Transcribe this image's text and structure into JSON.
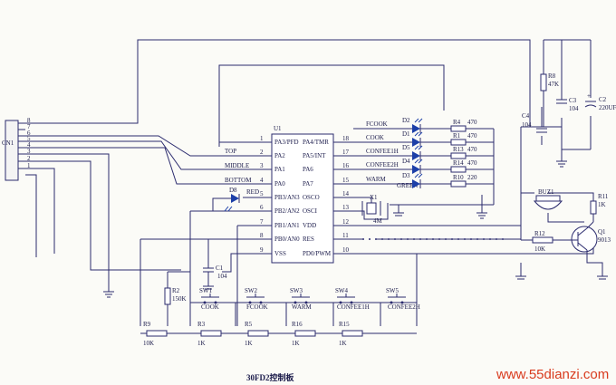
{
  "connector": {
    "ref": "CN1",
    "pins": [
      "8",
      "7",
      "6",
      "5",
      "4",
      "3",
      "2",
      "1"
    ]
  },
  "ic": {
    "ref": "U1",
    "left_pins": [
      {
        "num": "1",
        "name": "PA3/PFD"
      },
      {
        "num": "2",
        "name": "PA2"
      },
      {
        "num": "3",
        "name": "PA1"
      },
      {
        "num": "4",
        "name": "PA0"
      },
      {
        "num": "5",
        "name": "PB3/AN3"
      },
      {
        "num": "6",
        "name": "PB2/AN2"
      },
      {
        "num": "7",
        "name": "PB1/AN1"
      },
      {
        "num": "8",
        "name": "PB0/AN0"
      },
      {
        "num": "9",
        "name": "VSS"
      }
    ],
    "right_pins": [
      {
        "num": "18",
        "name": "PA4/TMR"
      },
      {
        "num": "17",
        "name": "PA5/INT"
      },
      {
        "num": "16",
        "name": "PA6"
      },
      {
        "num": "15",
        "name": "PA7"
      },
      {
        "num": "14",
        "name": "OSCO"
      },
      {
        "num": "13",
        "name": "OSCI"
      },
      {
        "num": "12",
        "name": "VDD"
      },
      {
        "num": "11",
        "name": "RES"
      },
      {
        "num": "10",
        "name": "PD0/PWM"
      }
    ]
  },
  "net_labels": {
    "top": "TOP",
    "middle": "MIDDLE",
    "bottom": "BOTTOM",
    "red": "RED"
  },
  "leds": [
    {
      "ref": "D2",
      "net": "FCOOK",
      "r_ref": "R4",
      "r_val": "470"
    },
    {
      "ref": "D1",
      "net": "COOK",
      "r_ref": "R1",
      "r_val": "470"
    },
    {
      "ref": "D5",
      "net": "CONFEE1H",
      "r_ref": "R13",
      "r_val": "470"
    },
    {
      "ref": "D4",
      "net": "CONFEE2H",
      "r_ref": "R14",
      "r_val": "470"
    },
    {
      "ref": "D3",
      "net": "WARM",
      "extra": "GREEN",
      "r_ref": "R10",
      "r_val": "220"
    }
  ],
  "led_red": {
    "ref": "D8"
  },
  "crystal": {
    "ref": "X1",
    "value": "4M"
  },
  "power": {
    "r8": {
      "ref": "R8",
      "value": "47K"
    },
    "c2": {
      "ref": "C2",
      "value": "220UF"
    },
    "c3": {
      "ref": "C3",
      "value": "104"
    },
    "c4": {
      "ref": "C4",
      "value": "104"
    }
  },
  "buzzer": {
    "ref": "BUZ1"
  },
  "transistor": {
    "ref": "Q1",
    "value": "9013"
  },
  "r11": {
    "ref": "R11",
    "value": "1K"
  },
  "r12": {
    "ref": "R12",
    "value": "10K"
  },
  "c1": {
    "ref": "C1",
    "value": "104"
  },
  "r2": {
    "ref": "R2",
    "value": "150K"
  },
  "switches": [
    {
      "ref": "SW1",
      "label": "COOK"
    },
    {
      "ref": "SW2",
      "label": "FCOOK"
    },
    {
      "ref": "SW3",
      "label": "WARM"
    },
    {
      "ref": "SW4",
      "label": "CONFEE1H"
    },
    {
      "ref": "SW5",
      "label": "CONFEE2H"
    }
  ],
  "bottom_resistors": [
    {
      "ref": "R9",
      "value": "10K"
    },
    {
      "ref": "R3",
      "value": "1K"
    },
    {
      "ref": "R5",
      "value": "1K"
    },
    {
      "ref": "R16",
      "value": "1K"
    },
    {
      "ref": "R15",
      "value": "1K"
    }
  ],
  "caption": "30FD2控制板",
  "watermark": "www.55dianzi.com"
}
